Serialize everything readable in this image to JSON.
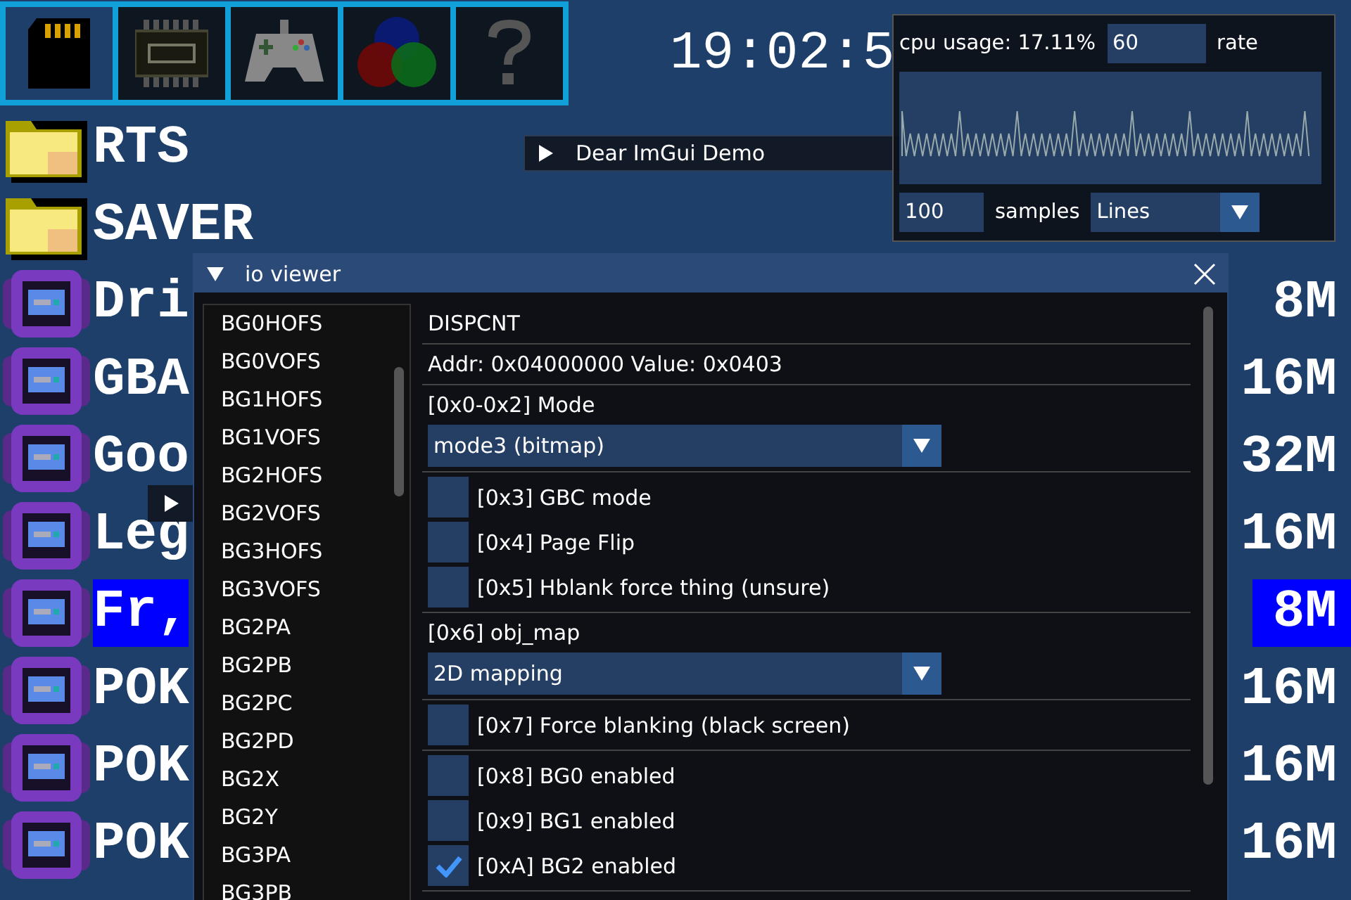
{
  "toolbar": {
    "tabs": [
      {
        "selected": true
      },
      {
        "selected": false
      },
      {
        "selected": false
      },
      {
        "selected": false
      },
      {
        "selected": false
      }
    ]
  },
  "clock": "19:02:5",
  "files": [
    {
      "kind": "folder",
      "name": "RTS",
      "selected": false
    },
    {
      "kind": "folder",
      "name": "SAVER",
      "selected": false
    },
    {
      "kind": "rom",
      "name": "Dri",
      "size": "8M",
      "selected": false
    },
    {
      "kind": "rom",
      "name": "GBA",
      "size": "16M",
      "selected": false
    },
    {
      "kind": "rom",
      "name": "Goo",
      "size": "32M",
      "selected": false
    },
    {
      "kind": "rom",
      "name": "Leg",
      "size": "16M",
      "selected": false
    },
    {
      "kind": "rom",
      "name": "Fr,",
      "size": "8M",
      "selected": true
    },
    {
      "kind": "rom",
      "name": "POK",
      "size": "16M",
      "selected": false
    },
    {
      "kind": "rom",
      "name": "POK",
      "size": "16M",
      "selected": false
    },
    {
      "kind": "rom",
      "name": "POK",
      "size": "16M",
      "selected": false
    }
  ],
  "demo_window": {
    "title": "Dear ImGui Demo",
    "expanded": false
  },
  "performance_window": {
    "cpu_usage": "cpu usage: 17.11%",
    "rate_value": "60",
    "rate_label": "rate",
    "samples_value": "100",
    "samples_label": "samples",
    "plot_style": "Lines"
  },
  "io_viewer": {
    "title": "io viewer",
    "expanded": true,
    "registers": [
      "BG0HOFS",
      "BG0VOFS",
      "BG1HOFS",
      "BG1VOFS",
      "BG2HOFS",
      "BG2VOFS",
      "BG3HOFS",
      "BG3VOFS",
      "BG2PA",
      "BG2PB",
      "BG2PC",
      "BG2PD",
      "BG2X",
      "BG2Y",
      "BG3PA",
      "BG3PB"
    ],
    "sections": [
      [
        {
          "kind": "text",
          "text": "DISPCNT"
        }
      ],
      [
        {
          "kind": "text",
          "text": "Addr: 0x04000000 Value: 0x0403"
        }
      ],
      [
        {
          "kind": "text",
          "text": "[0x0-0x2] Mode"
        },
        {
          "kind": "combo",
          "value": "mode3 (bitmap)"
        }
      ],
      [
        {
          "kind": "checkbox",
          "label": "[0x3] GBC mode",
          "checked": false
        },
        {
          "kind": "checkbox",
          "label": "[0x4] Page Flip",
          "checked": false
        },
        {
          "kind": "checkbox",
          "label": "[0x5] Hblank force thing (unsure)",
          "checked": false
        }
      ],
      [
        {
          "kind": "text",
          "text": "[0x6] obj_map"
        },
        {
          "kind": "combo",
          "value": "2D mapping"
        }
      ],
      [
        {
          "kind": "checkbox",
          "label": "[0x7] Force blanking (black screen)",
          "checked": false
        }
      ],
      [
        {
          "kind": "checkbox",
          "label": "[0x8] BG0 enabled",
          "checked": false
        },
        {
          "kind": "checkbox",
          "label": "[0x9] BG1 enabled",
          "checked": false
        },
        {
          "kind": "checkbox",
          "label": "[0xA] BG2 enabled",
          "checked": true
        }
      ]
    ]
  }
}
